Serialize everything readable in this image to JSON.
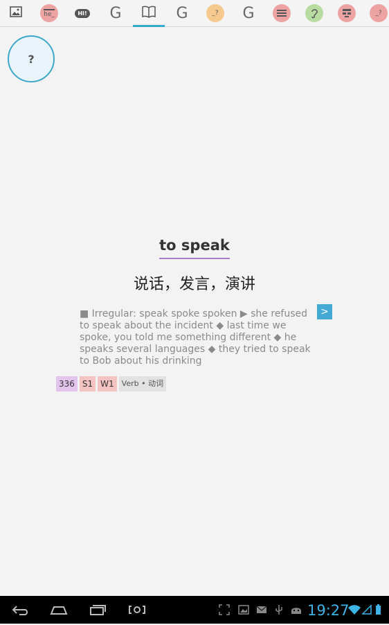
{
  "tabs": [
    {
      "name": "image-tab",
      "icon": "image-icon",
      "text": ""
    },
    {
      "name": "he-tab",
      "icon": "fill-blank-he-icon",
      "text": "he_"
    },
    {
      "name": "hi-tab",
      "icon": "speech-bubble-hi-icon",
      "text": "HI!"
    },
    {
      "name": "google-tab-1",
      "icon": "google-g-icon",
      "text": "G"
    },
    {
      "name": "book-tab",
      "icon": "book-icon",
      "text": ""
    },
    {
      "name": "google-tab-2",
      "icon": "google-g-icon",
      "text": "G"
    },
    {
      "name": "quiz-tab-orange",
      "icon": "fill-blank-quiz-icon",
      "text": "_?"
    },
    {
      "name": "google-tab-3",
      "icon": "google-g-icon",
      "text": "G"
    },
    {
      "name": "lines-tab",
      "icon": "text-lines-icon",
      "text": ""
    },
    {
      "name": "ear-tab",
      "icon": "ear-icon",
      "text": ""
    },
    {
      "name": "grid-tab",
      "icon": "grid-blocks-icon",
      "text": ""
    },
    {
      "name": "quiz-tab-red",
      "icon": "fill-blank-quiz-icon",
      "text": "_?"
    }
  ],
  "active_tab": "book-tab",
  "help": {
    "label": "?"
  },
  "entry": {
    "word": "to speak",
    "translation": "说话，发言，演讲",
    "definition": "■ Irregular: speak spoke spoken ▶ she refused to speak about the incident ◆ last time we spoke, you told me something different ◆ he speaks several languages ◆ they tried to speak to Bob about his drinking",
    "next_label": ">",
    "tags": {
      "frequency": "336",
      "spoken": "S1",
      "written": "W1",
      "pos": "Verb • 动词"
    }
  },
  "colors": {
    "accent": "#33a9cf",
    "underline": "#a87bc7",
    "clock": "#3cb4e6"
  },
  "status_bar": {
    "time": "19:27"
  }
}
